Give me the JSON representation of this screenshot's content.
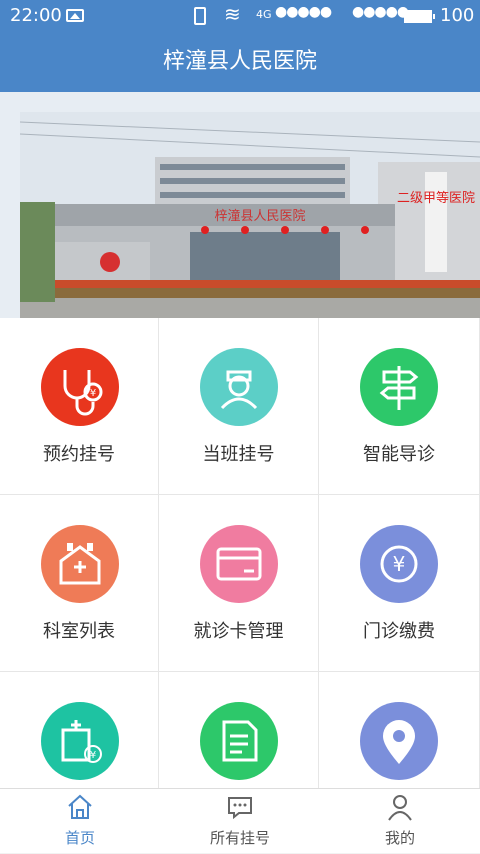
{
  "status_bar": {
    "time": "22:00",
    "network": "4G",
    "signal1": "●●●●●",
    "signal2": "●●●●●",
    "battery": "100"
  },
  "header": {
    "title": "梓潼县人民医院"
  },
  "banner": {
    "building_sign": "梓潼县人民医院",
    "side_sign": "二级甲等医院"
  },
  "menu": {
    "items": [
      {
        "label": "预约挂号",
        "icon": "stethoscope-icon",
        "color": "#e8361e"
      },
      {
        "label": "当班挂号",
        "icon": "nurse-icon",
        "color": "#5ccfc7"
      },
      {
        "label": "智能导诊",
        "icon": "signpost-icon",
        "color": "#2dc86a"
      },
      {
        "label": "科室列表",
        "icon": "department-icon",
        "color": "#ef7b57"
      },
      {
        "label": "就诊卡管理",
        "icon": "card-icon",
        "color": "#f07ca0"
      },
      {
        "label": "门诊缴费",
        "icon": "yuan-icon",
        "color": "#7b8fdb"
      },
      {
        "label": "",
        "icon": "hospital-bill-icon",
        "color": "#1ec3a2"
      },
      {
        "label": "",
        "icon": "document-icon",
        "color": "#2dc86a"
      },
      {
        "label": "",
        "icon": "location-icon",
        "color": "#7b8fdb"
      }
    ]
  },
  "tabbar": {
    "home": "首页",
    "all_registrations": "所有挂号",
    "mine": "我的",
    "active_color": "#4a86c8"
  }
}
